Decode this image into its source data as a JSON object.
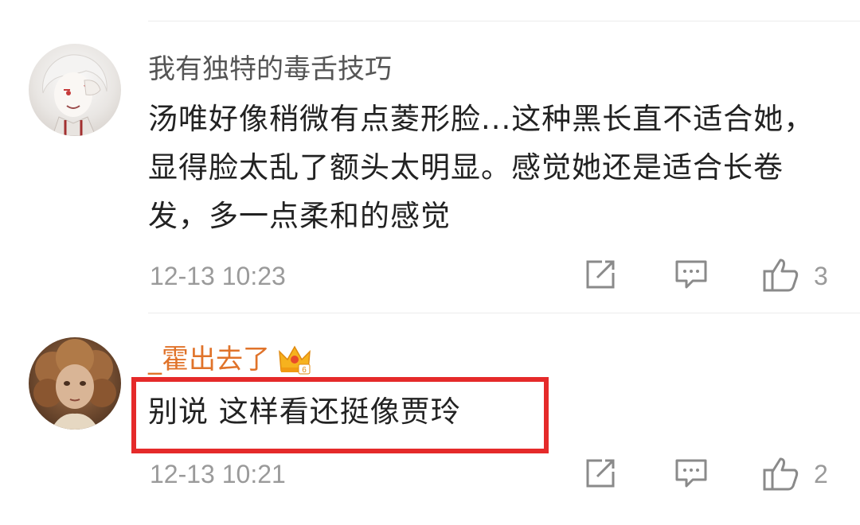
{
  "comments": [
    {
      "username": "我有独特的毒舌技巧",
      "text": "汤唯好像稍微有点菱形脸...这种黑长直不适合她，显得脸太乱了额头太明显。感觉她还是适合长卷发，多一点柔和的感觉",
      "time": "12-13 10:23",
      "likes": "3",
      "name_color": "#555555"
    },
    {
      "username": "_霍出去了",
      "badge_icon": "crown-vip-badge-icon",
      "text": "别说 这样看还挺像贾玲",
      "time": "12-13 10:21",
      "likes": "2",
      "name_color": "#e0732a",
      "highlight_color": "#e52a2a"
    }
  ],
  "icons": {
    "repost": "repost-icon",
    "reply": "reply-icon",
    "like": "thumbs-up-icon"
  }
}
